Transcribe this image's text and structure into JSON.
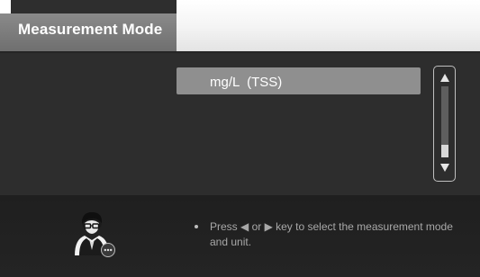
{
  "header": {
    "title": "Measurement Mode"
  },
  "main": {
    "selected_option": "mg/L  (TSS)"
  },
  "scrollbar": {
    "up_icon": "triangle-up",
    "down_icon": "triangle-down",
    "position_fraction": 1.0
  },
  "help": {
    "message": "Press ◀ or ▶ key to select the measurement mode and unit."
  },
  "icons": {
    "avatar": "user-chat-avatar-icon"
  },
  "colors": {
    "title_tab": "#7c7c7c",
    "selected_row": "#8f8f8f",
    "background": "#2e2e2e",
    "help_text": "#a8a8a8"
  }
}
